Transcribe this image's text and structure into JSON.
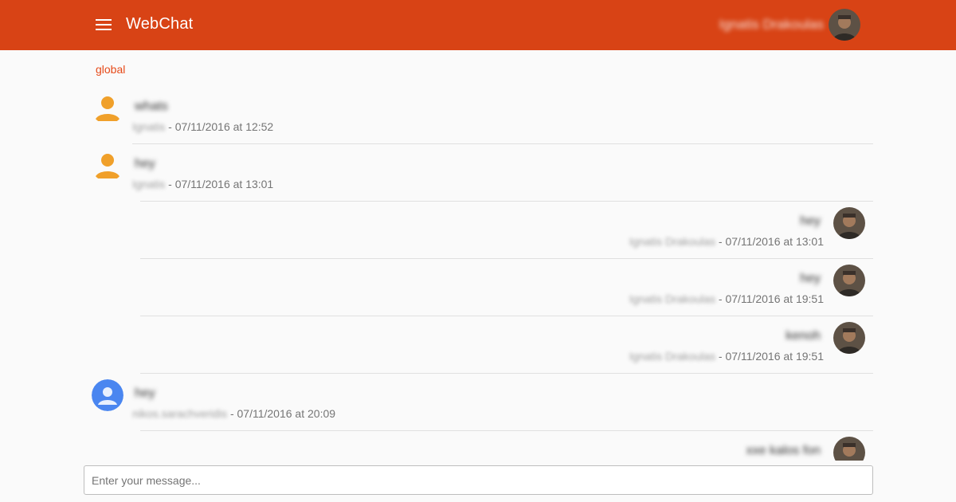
{
  "app": {
    "title": "WebChat",
    "user_name": "Ignatis Drakoulas",
    "accent_color": "#d84315"
  },
  "channel": {
    "name": "global"
  },
  "messages": [
    {
      "side": "left",
      "avatar": "default-user-icon",
      "text": "whats",
      "author": "Ignatis",
      "separator": " - ",
      "timestamp": "07/11/2016 at 12:52"
    },
    {
      "side": "left",
      "avatar": "default-user-icon",
      "text": "hey",
      "author": "Ignatis",
      "separator": " - ",
      "timestamp": "07/11/2016 at 13:01"
    },
    {
      "side": "right",
      "avatar": "user-photo",
      "text": "hey",
      "author": "Ignatis Drakoulas",
      "separator": " - ",
      "timestamp": "07/11/2016 at 13:01"
    },
    {
      "side": "right",
      "avatar": "user-photo",
      "text": "hey",
      "author": "Ignatis Drakoulas",
      "separator": " - ",
      "timestamp": "07/11/2016 at 19:51"
    },
    {
      "side": "right",
      "avatar": "user-photo",
      "text": "kenoh",
      "author": "Ignatis Drakoulas",
      "separator": " - ",
      "timestamp": "07/11/2016 at 19:51"
    },
    {
      "side": "left",
      "avatar": "google-user-icon",
      "text": "hey",
      "author": "nikos.sarachveridis",
      "separator": " - ",
      "timestamp": "07/11/2016 at 20:09"
    },
    {
      "side": "right",
      "avatar": "user-photo",
      "text": "xxe kalos fon",
      "author": "",
      "separator": "",
      "timestamp": ""
    }
  ],
  "composer": {
    "placeholder": "Enter your message..."
  }
}
